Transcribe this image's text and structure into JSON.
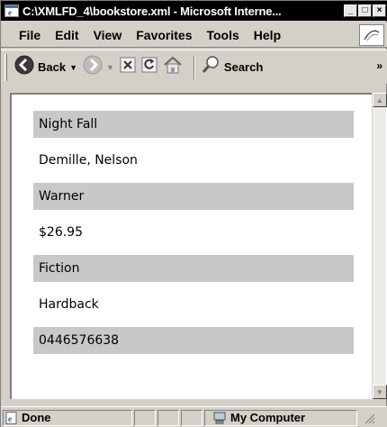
{
  "window": {
    "title": "C:\\XMLFD_4\\bookstore.xml - Microsoft Interne...",
    "minimize_label": "_",
    "maximize_label": "□",
    "close_label": "×"
  },
  "menu": {
    "items": [
      {
        "label": "File"
      },
      {
        "label": "Edit"
      },
      {
        "label": "View"
      },
      {
        "label": "Favorites"
      },
      {
        "label": "Tools"
      },
      {
        "label": "Help"
      }
    ]
  },
  "toolbar": {
    "back_label": "Back",
    "search_label": "Search",
    "more_label": "»"
  },
  "book": {
    "fields": [
      {
        "value": "Night Fall",
        "shaded": true
      },
      {
        "value": "Demille, Nelson",
        "shaded": false
      },
      {
        "value": "Warner",
        "shaded": true
      },
      {
        "value": "$26.95",
        "shaded": false
      },
      {
        "value": "Fiction",
        "shaded": true
      },
      {
        "value": "Hardback",
        "shaded": false
      },
      {
        "value": "0446576638",
        "shaded": true
      }
    ]
  },
  "status": {
    "text": "Done",
    "zone": "My Computer"
  },
  "colors": {
    "field_shade": "#c8c8c8",
    "chrome": "#d4d0c8",
    "titlebar": "#000000"
  },
  "icons": [
    "ie-page-icon",
    "back-arrow-icon",
    "forward-arrow-icon",
    "stop-icon",
    "refresh-icon",
    "home-icon",
    "search-icon",
    "ie-logo-icon",
    "page-done-icon",
    "computer-icon"
  ]
}
